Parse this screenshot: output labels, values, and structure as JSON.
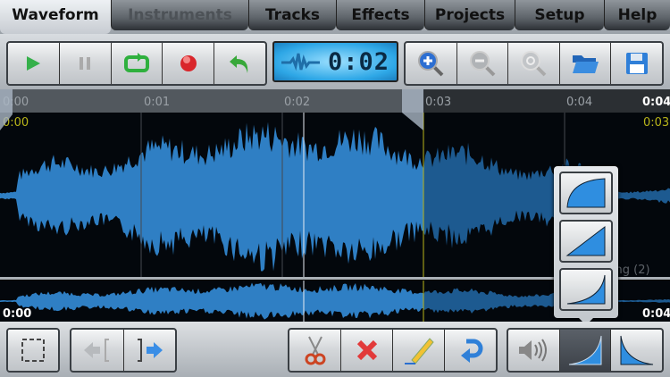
{
  "tabs": [
    {
      "label": "Waveform",
      "state": "active"
    },
    {
      "label": "Instruments",
      "state": "disabled"
    },
    {
      "label": "Tracks",
      "state": "normal"
    },
    {
      "label": "Effects",
      "state": "normal"
    },
    {
      "label": "Projects",
      "state": "normal"
    },
    {
      "label": "Setup",
      "state": "normal"
    },
    {
      "label": "Help",
      "state": "normal"
    }
  ],
  "display": {
    "time": "0:02"
  },
  "ruler": {
    "ticks": [
      "0:00",
      "0:01",
      "0:02",
      "0:03",
      "0:04"
    ],
    "end_label": "0:04",
    "selection_start": "0:00",
    "selection_end": "0:03"
  },
  "overview": {
    "start": "0:00",
    "end": "0:04"
  },
  "track": {
    "name": "Recording (2)"
  },
  "colors": {
    "wave": "#2f7fc4",
    "wave_dim": "#1d5a90",
    "selection_marker": "#b8b41a",
    "lcd": "#2ea7e6"
  }
}
